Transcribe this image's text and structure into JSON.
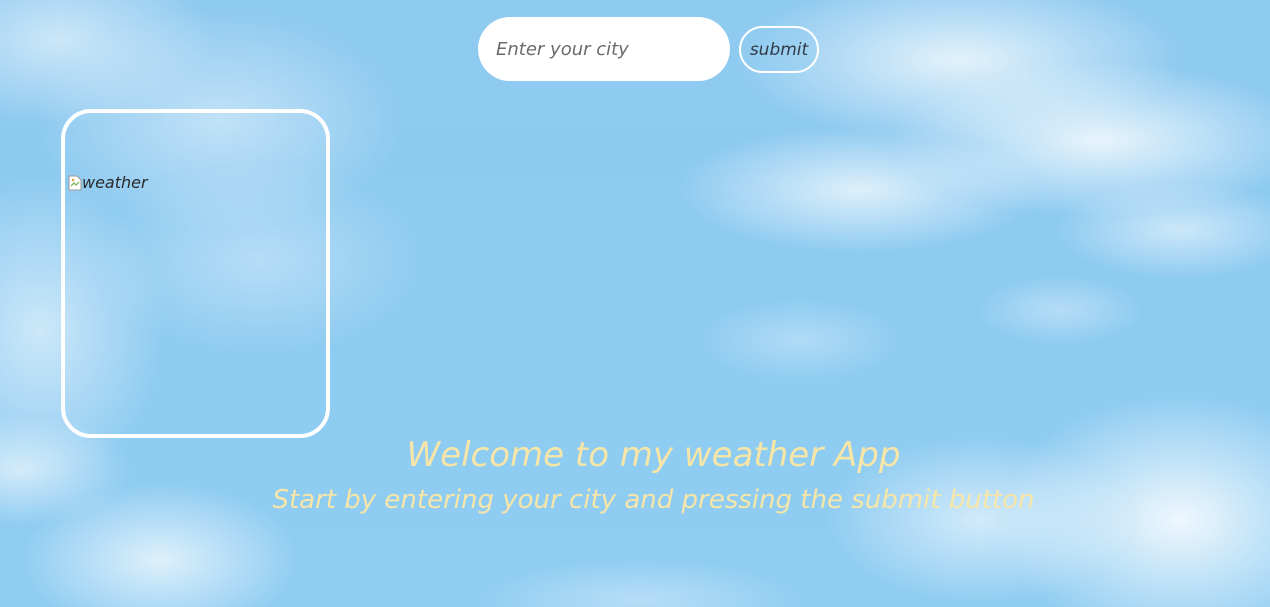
{
  "search": {
    "placeholder": "Enter your city",
    "value": ""
  },
  "submit": {
    "label": "submit"
  },
  "weather_card": {
    "image_alt": "weather",
    "icon": "broken-image-icon"
  },
  "welcome": {
    "title": "Welcome to my weather App",
    "subtitle": "Start by entering your city and pressing the submit button"
  },
  "colors": {
    "sky": "#8ecbf1",
    "welcome_text": "#f7e6a8",
    "card_border": "#ffffff",
    "input_bg": "#ffffff"
  }
}
